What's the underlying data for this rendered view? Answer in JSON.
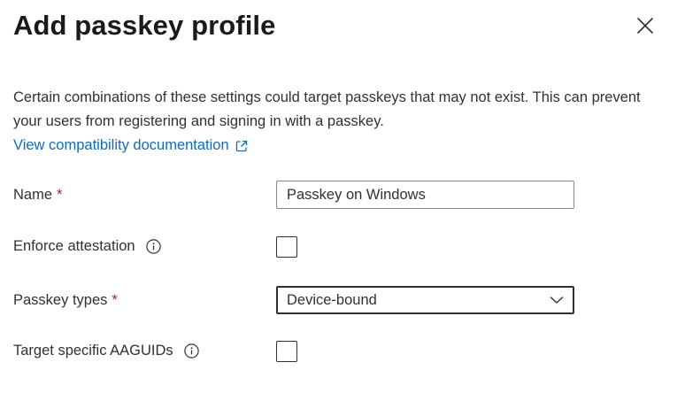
{
  "panel": {
    "title": "Add passkey profile",
    "close_icon": "close-icon"
  },
  "description": "Certain combinations of these settings could target passkeys that may not exist. This can prevent your users from registering and signing in with a passkey.",
  "compatibility_link": {
    "label": "View compatibility documentation",
    "icon": "external-link-icon"
  },
  "form": {
    "name": {
      "label": "Name",
      "required_marker": "*",
      "value": "Passkey on Windows"
    },
    "enforce_attestation": {
      "label": "Enforce attestation",
      "info_icon": "info-icon",
      "checked": false
    },
    "passkey_types": {
      "label": "Passkey types",
      "required_marker": "*",
      "selected": "Device-bound",
      "chevron_icon": "chevron-down-icon"
    },
    "target_aaguids": {
      "label": "Target specific AAGUIDs",
      "info_icon": "info-icon",
      "checked": false
    }
  },
  "colors": {
    "link": "#0f6cbd",
    "required": "#a4262c",
    "text": "#323130"
  }
}
